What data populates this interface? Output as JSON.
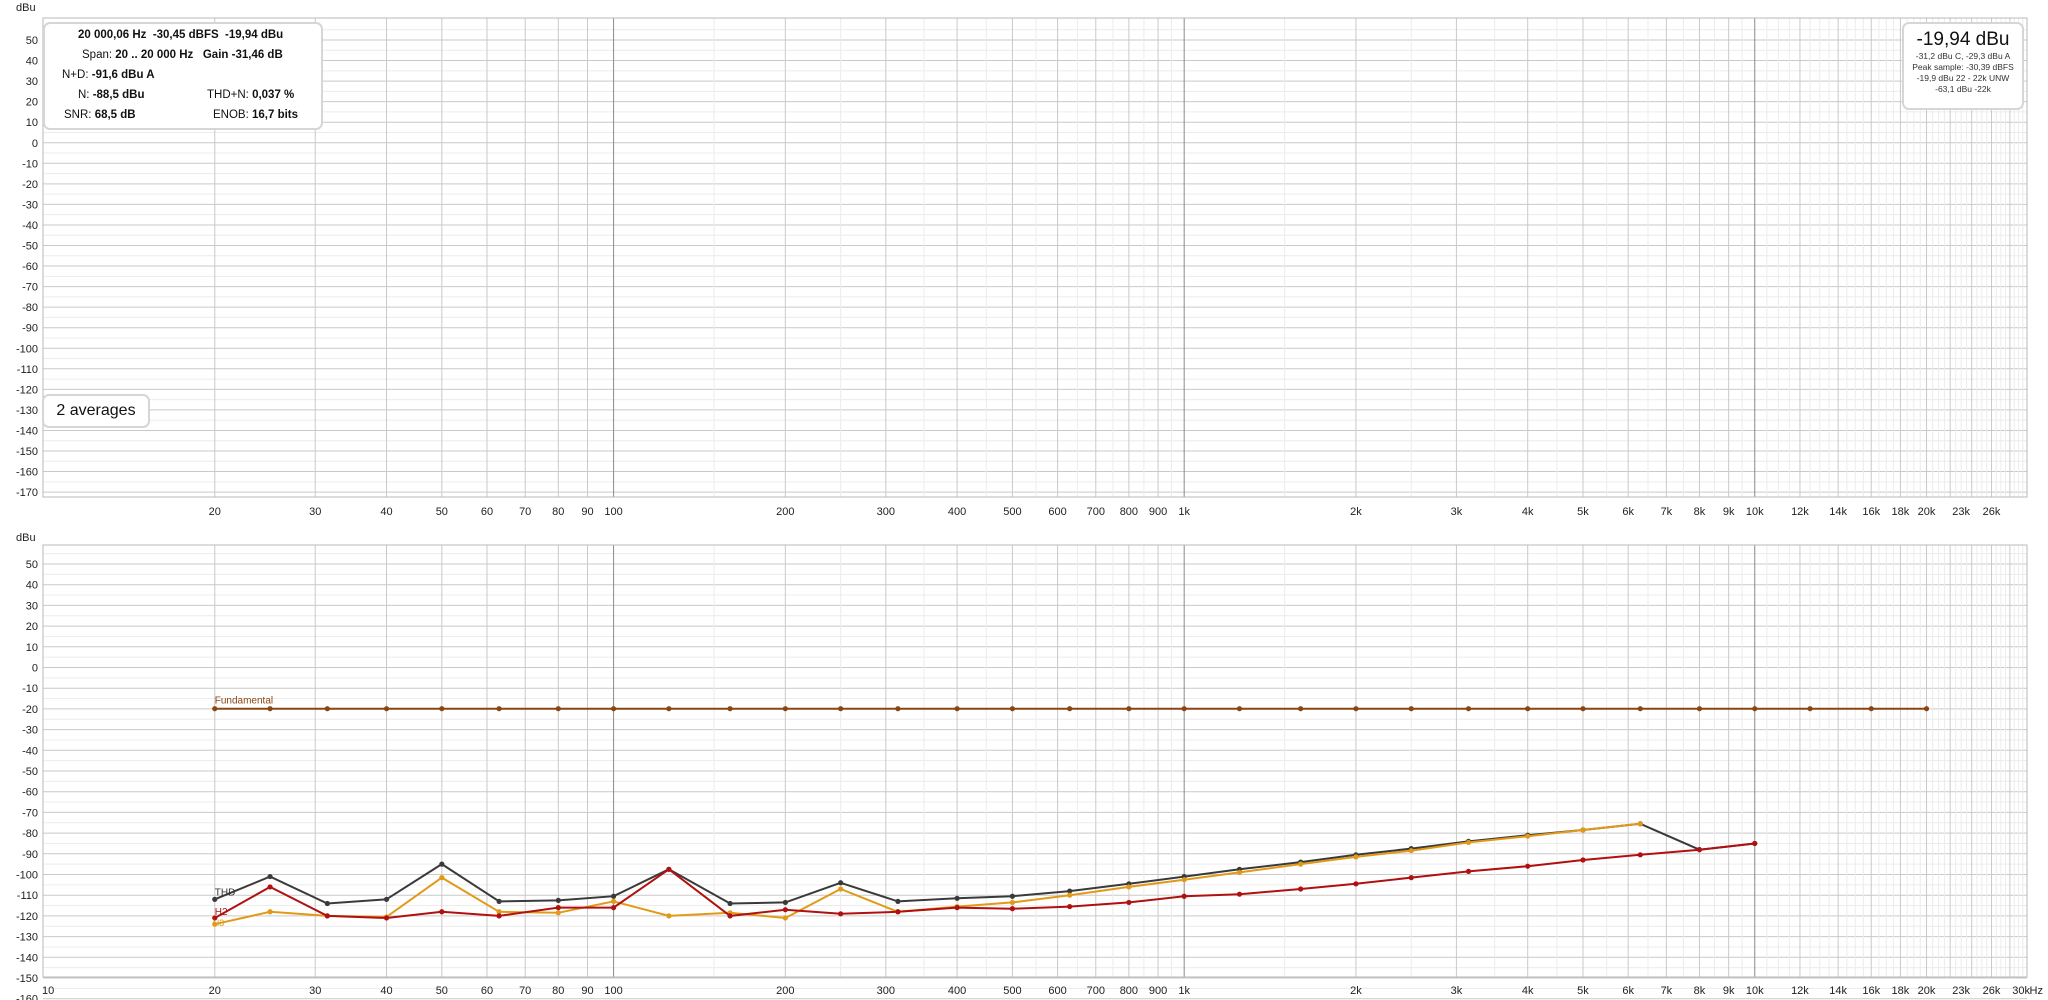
{
  "top_panel": {
    "unit": "dBu",
    "y_ticks": [
      50,
      40,
      30,
      20,
      10,
      0,
      -10,
      -20,
      -30,
      -40,
      -50,
      -60,
      -70,
      -80,
      -90,
      -100,
      -110,
      -120,
      -130,
      -140,
      -150,
      -160,
      -170
    ],
    "x_ticks": [
      "20",
      "30",
      "40",
      "50",
      "60",
      "70",
      "80",
      "90",
      "100",
      "200",
      "300",
      "400",
      "500",
      "600",
      "700",
      "800",
      "900",
      "1k",
      "2k",
      "3k",
      "4k",
      "5k",
      "6k",
      "7k",
      "8k",
      "9k",
      "10k",
      "12k",
      "14k",
      "16k",
      "18k",
      "20k",
      "23k",
      "26k"
    ],
    "info": {
      "freq": "20 000,06 Hz",
      "dbfs": "-30,45 dBFS",
      "dbu": "-19,94 dBu",
      "span_label": "Span:",
      "span": "20 .. 20 000 Hz",
      "gain_label": "Gain",
      "gain": "-31,46 dB",
      "nd_label": "N+D:",
      "nd": "-91,6 dBu A",
      "n_label": "N:",
      "n": "-88,5 dBu",
      "thdn_label": "THD+N:",
      "thdn": "0,037 %",
      "snr_label": "SNR:",
      "snr": "68,5 dB",
      "enob_label": "ENOB:",
      "enob": "16,7 bits"
    },
    "averages": "2 averages",
    "level": {
      "main": "-19,94 dBu",
      "line1": "-31,2 dBu C, -29,3 dBu A",
      "line2": "Peak sample: -30,39 dBFS",
      "line3": "-19,9 dBu 22 - 22k UNW",
      "line4": "-63,1 dBu -22k"
    }
  },
  "bottom_panel": {
    "unit": "dBu",
    "x_unit": "Hz",
    "x_ticks": [
      "10",
      "20",
      "30",
      "40",
      "50",
      "60",
      "70",
      "80",
      "90",
      "100",
      "200",
      "300",
      "400",
      "500",
      "600",
      "700",
      "800",
      "900",
      "1k",
      "2k",
      "3k",
      "4k",
      "5k",
      "6k",
      "7k",
      "8k",
      "9k",
      "10k",
      "12k",
      "14k",
      "16k",
      "18k",
      "20k",
      "23k",
      "26k",
      "30k"
    ]
  },
  "colors": {
    "fundamental": "#8b4513",
    "thd": "#3a3a3a",
    "h2": "#b01010",
    "h3": "#e09a18"
  },
  "chart_data": {
    "type": "line",
    "x_scale": "log",
    "xlim": [
      10,
      30000
    ],
    "ylim": [
      -170,
      55
    ],
    "ylabel": "dBu",
    "xlabel": "Hz",
    "grid": true,
    "series": [
      {
        "name": "Fundamental",
        "x": [
          20,
          25,
          31.5,
          40,
          50,
          63,
          80,
          100,
          125,
          160,
          200,
          250,
          315,
          400,
          500,
          630,
          800,
          1000,
          1250,
          1600,
          2000,
          2500,
          3150,
          4000,
          5000,
          6300,
          8000,
          10000,
          12500,
          16000,
          20000
        ],
        "y": [
          -19.9,
          -19.9,
          -19.9,
          -19.9,
          -19.9,
          -19.9,
          -19.9,
          -19.9,
          -19.9,
          -19.9,
          -19.9,
          -19.9,
          -19.9,
          -19.9,
          -19.9,
          -19.9,
          -19.9,
          -19.9,
          -19.9,
          -19.9,
          -19.9,
          -19.9,
          -19.9,
          -19.9,
          -19.9,
          -19.9,
          -19.9,
          -19.9,
          -19.9,
          -19.9,
          -19.9
        ]
      },
      {
        "name": "THD",
        "x": [
          20,
          25,
          31.5,
          40,
          50,
          63,
          80,
          100,
          125,
          160,
          200,
          250,
          315,
          400,
          500,
          630,
          800,
          1000,
          1250,
          1600,
          2000,
          2500,
          3150,
          4000,
          5000,
          6300,
          8000,
          10000
        ],
        "y": [
          -112,
          -101,
          -114,
          -112,
          -95,
          -113,
          -112.5,
          -110.5,
          -97.5,
          -114,
          -113.5,
          -104,
          -113,
          -111.5,
          -110.5,
          -108,
          -104.5,
          -101,
          -97.5,
          -94,
          -90.5,
          -87.5,
          -84,
          -81,
          -78.5,
          -75.5,
          -88,
          -85
        ]
      },
      {
        "name": "H2",
        "x": [
          20,
          25,
          31.5,
          40,
          50,
          63,
          80,
          100,
          125,
          160,
          200,
          250,
          315,
          400,
          500,
          630,
          800,
          1000,
          1250,
          1600,
          2000,
          2500,
          3150,
          4000,
          5000,
          6300,
          8000,
          10000
        ],
        "y": [
          -121,
          -106,
          -120,
          -121,
          -118,
          -120,
          -116,
          -116,
          -97.5,
          -120,
          -117,
          -119,
          -118,
          -116,
          -116.5,
          -115.5,
          -113.5,
          -110.5,
          -109.5,
          -107,
          -104.5,
          -101.5,
          -98.5,
          -96,
          -93,
          -90.5,
          -88,
          -85
        ]
      },
      {
        "name": "H3",
        "x": [
          20,
          25,
          31.5,
          40,
          50,
          63,
          80,
          100,
          125,
          160,
          200,
          250,
          315,
          400,
          500,
          630,
          800,
          1000,
          1250,
          1600,
          2000,
          2500,
          3150,
          4000,
          5000,
          6300
        ],
        "y": [
          -124,
          -118,
          -120,
          -120.5,
          -101.5,
          -118,
          -118.5,
          -113,
          -120,
          -118.5,
          -121,
          -107,
          -118,
          -115.5,
          -113.5,
          -110,
          -106,
          -102.5,
          -99,
          -95,
          -91.5,
          -88.5,
          -84.5,
          -81.5,
          -78.5,
          -75.5
        ]
      }
    ]
  }
}
